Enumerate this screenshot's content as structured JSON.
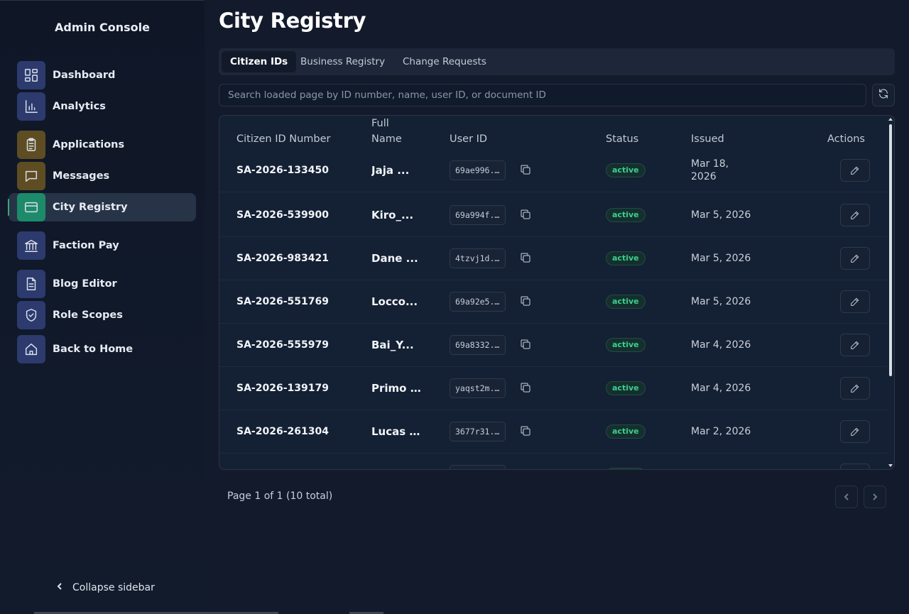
{
  "sidebar": {
    "brand": "Admin Console",
    "items": [
      {
        "label": "Dashboard",
        "icon": "dashboard-icon",
        "color": "#2c3a6e"
      },
      {
        "label": "Analytics",
        "icon": "bar-chart-icon",
        "color": "#2c3a6e"
      },
      {
        "label": "Applications",
        "icon": "clipboard-icon",
        "color": "#5e4d22"
      },
      {
        "label": "Messages",
        "icon": "message-icon",
        "color": "#5e4d22"
      },
      {
        "label": "City Registry",
        "icon": "id-card-icon",
        "color": "#1d8a6a",
        "active": true
      },
      {
        "label": "Faction Pay",
        "icon": "bank-icon",
        "color": "#2c3a6e"
      },
      {
        "label": "Blog Editor",
        "icon": "document-icon",
        "color": "#2c3a6e"
      },
      {
        "label": "Role Scopes",
        "icon": "shield-icon",
        "color": "#2c3a6e"
      },
      {
        "label": "Back to Home",
        "icon": "home-icon",
        "color": "#2c3a6e"
      }
    ],
    "collapse_label": "Collapse sidebar"
  },
  "page": {
    "title": "City Registry",
    "tabs": [
      {
        "label": "Citizen IDs",
        "active": true
      },
      {
        "label": "Business Registry"
      },
      {
        "label": "Change Requests"
      }
    ],
    "search_placeholder": "Search loaded page by ID number, name, user ID, or document ID"
  },
  "table": {
    "headers": {
      "id": "Citizen ID Number",
      "name_line1": "Full",
      "name_line2": "Name",
      "user_id": "User ID",
      "status": "Status",
      "issued": "Issued",
      "actions": "Actions"
    },
    "rows": [
      {
        "id": "SA-2026-133450",
        "name": "Jaja ...",
        "user_id": "69ae996...",
        "status": "active",
        "issued_line1": "Mar 18,",
        "issued_line2": "2026"
      },
      {
        "id": "SA-2026-539900",
        "name": "Kiro_...",
        "user_id": "69a994f...",
        "status": "active",
        "issued_line1": "Mar 5, 2026",
        "issued_line2": ""
      },
      {
        "id": "SA-2026-983421",
        "name": "Dane ...",
        "user_id": "4tzvj1d...",
        "status": "active",
        "issued_line1": "Mar 5, 2026",
        "issued_line2": ""
      },
      {
        "id": "SA-2026-551769",
        "name": "Locco...",
        "user_id": "69a92e5...",
        "status": "active",
        "issued_line1": "Mar 5, 2026",
        "issued_line2": ""
      },
      {
        "id": "SA-2026-555979",
        "name": "Bai_Y...",
        "user_id": "69a8332...",
        "status": "active",
        "issued_line1": "Mar 4, 2026",
        "issued_line2": ""
      },
      {
        "id": "SA-2026-139179",
        "name": "Primo ...",
        "user_id": "yaqst2m...",
        "status": "active",
        "issued_line1": "Mar 4, 2026",
        "issued_line2": ""
      },
      {
        "id": "SA-2026-261304",
        "name": "Lucas ...",
        "user_id": "3677r31...",
        "status": "active",
        "issued_line1": "Mar 2, 2026",
        "issued_line2": ""
      }
    ]
  },
  "pagination": {
    "info": "Page 1 of 1 (10 total)"
  },
  "colors": {
    "accent": "#1d8a6a",
    "status_active": "#3bd08e",
    "background": "#121a2b"
  }
}
